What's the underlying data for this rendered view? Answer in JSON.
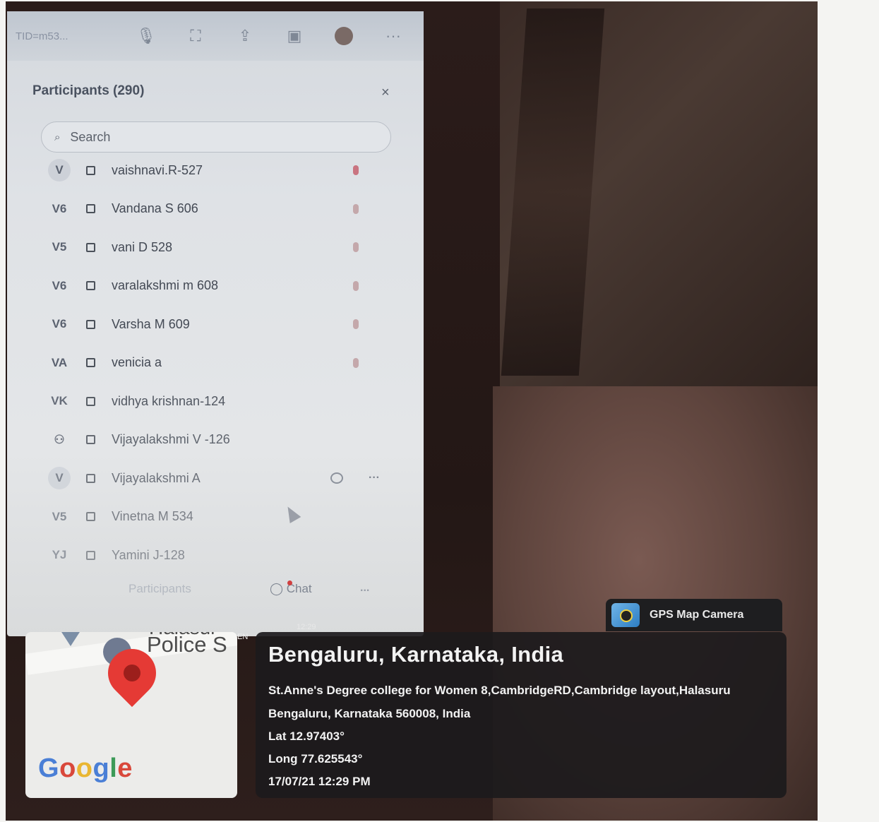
{
  "window": {
    "toolbar_id": "TID=m53...",
    "icons": [
      "mic-icon",
      "video-icon",
      "share-icon",
      "reactions-icon",
      "avatar",
      "more-icon"
    ]
  },
  "participants_panel": {
    "title": "Participants (290)",
    "close_label": "×",
    "search_placeholder": "Search",
    "participants": [
      {
        "initials": "V",
        "name": "vaishnavi.R-527",
        "mic": "muted-red"
      },
      {
        "initials": "V6",
        "name": "Vandana S 606",
        "mic": "muted"
      },
      {
        "initials": "V5",
        "name": "vani D 528",
        "mic": "muted"
      },
      {
        "initials": "V6",
        "name": "varalakshmi m 608",
        "mic": "muted"
      },
      {
        "initials": "V6",
        "name": "Varsha M 609",
        "mic": "muted"
      },
      {
        "initials": "VA",
        "name": "venicia  a",
        "mic": "muted"
      },
      {
        "initials": "VK",
        "name": "vidhya krishnan-124",
        "mic": "none"
      },
      {
        "initials": "",
        "name": "Vijayalakshmi V -126",
        "mic": "none"
      },
      {
        "initials": "V",
        "name": "Vijayalakshmi A",
        "mic": "none"
      },
      {
        "initials": "V5",
        "name": "Vinetna M 534",
        "mic": "none"
      },
      {
        "initials": "YJ",
        "name": "Yamini J-128",
        "mic": "none"
      }
    ],
    "bottom_bar": {
      "participants_label": "Participants",
      "chat_label": "Chat",
      "more_label": "..."
    }
  },
  "gps_overlay": {
    "badge_label": "GPS Map Camera",
    "map_place_text": "Police S",
    "map_place_top": "Halasur",
    "map_en": "EN",
    "map_time": "12:29",
    "google_logo": [
      "G",
      "o",
      "o",
      "g",
      "l",
      "e"
    ],
    "city": "Bengaluru, Karnataka, India",
    "address": "St.Anne's Degree college for Women 8,CambridgeRD,Cambridge layout,Halasuru Bengaluru, Karnataka 560008, India",
    "lat": "Lat 12.97403°",
    "long": "Long 77.625543°",
    "datetime": "17/07/21 12:29 PM"
  }
}
